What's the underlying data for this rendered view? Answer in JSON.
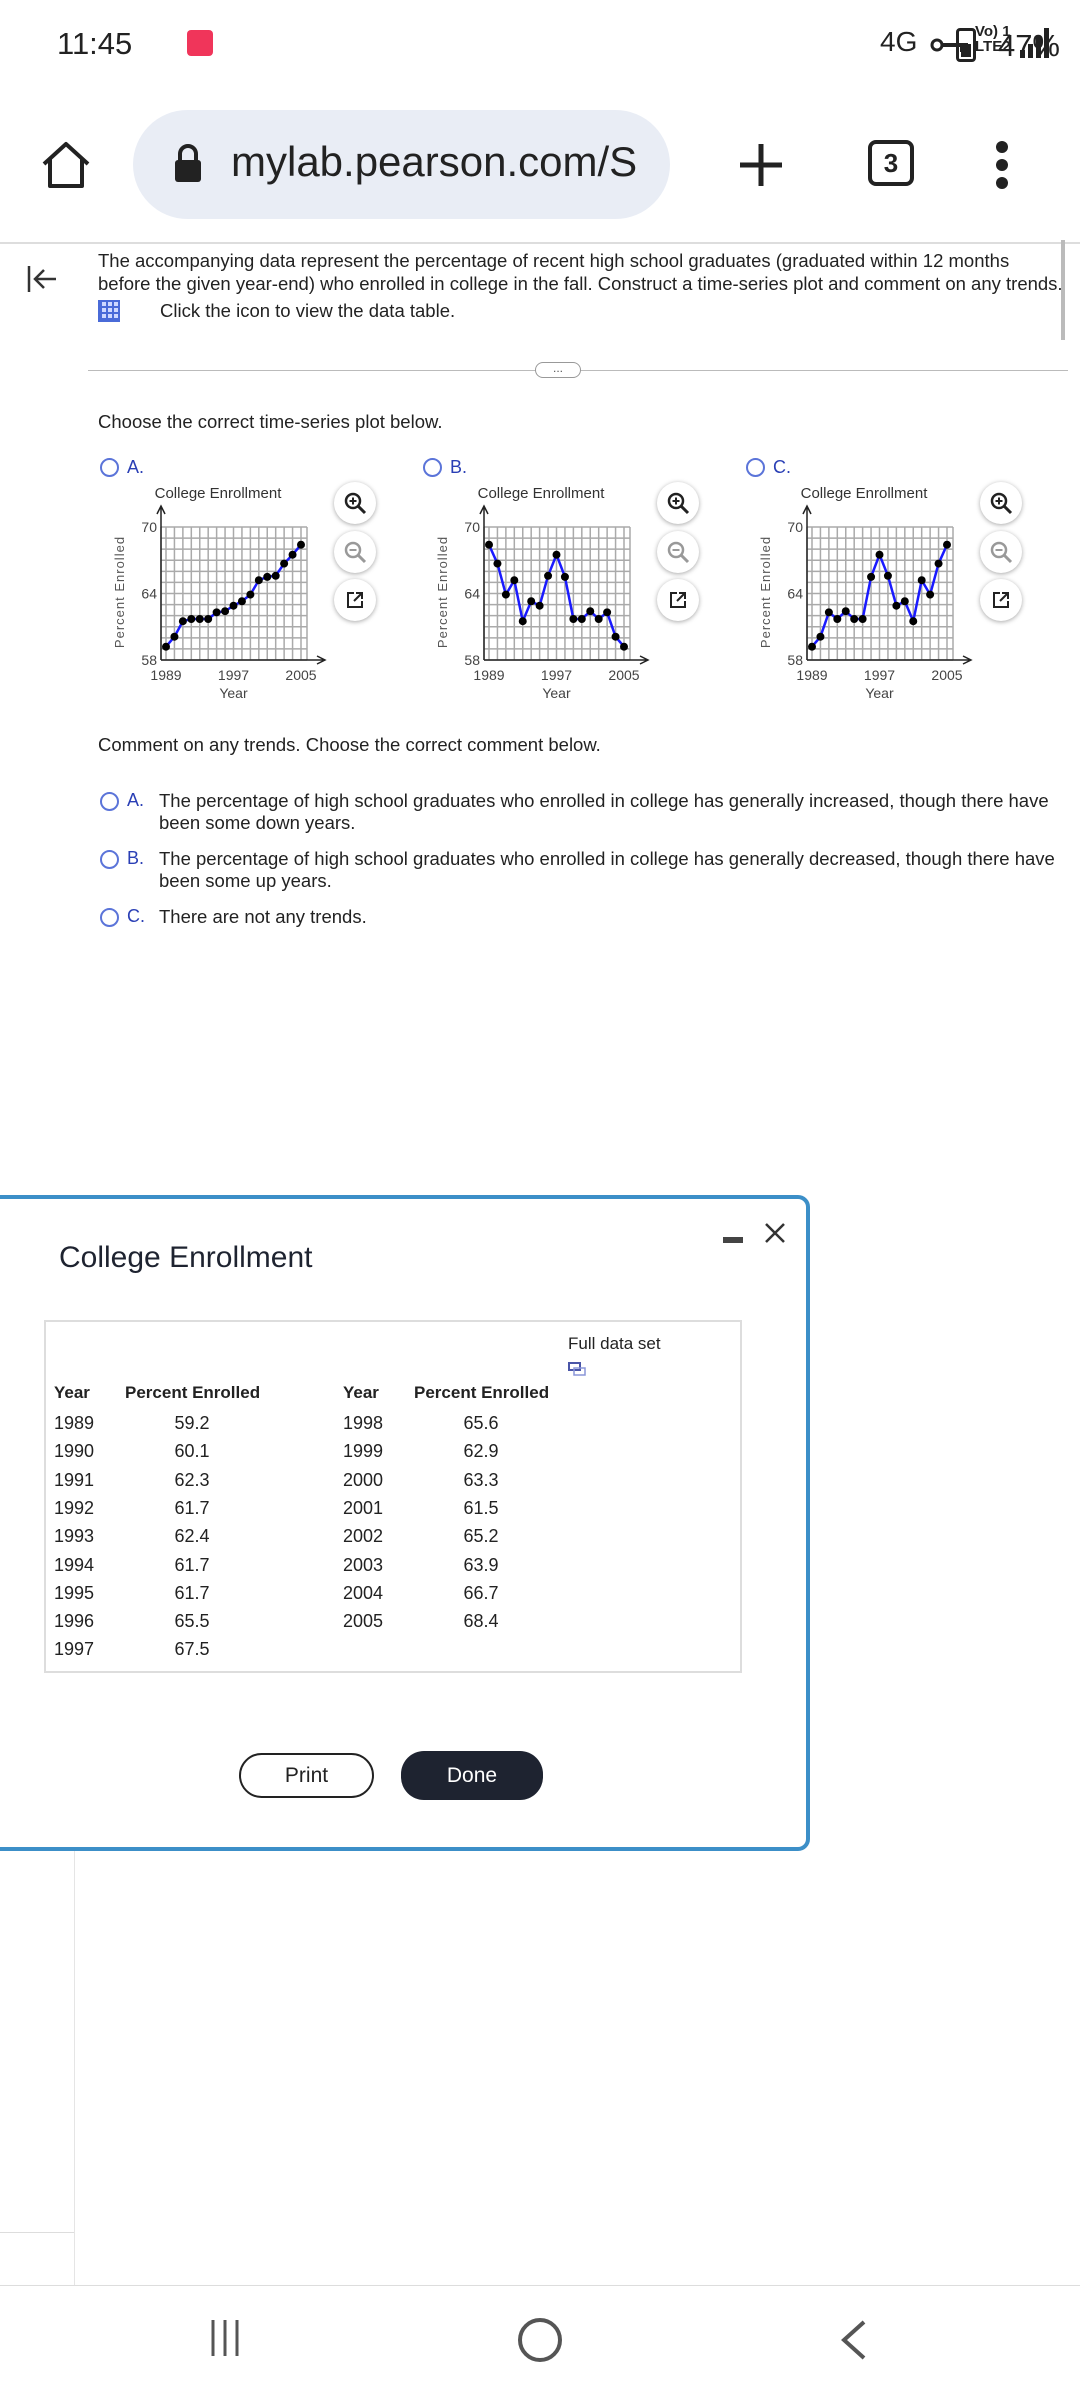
{
  "status_bar": {
    "time": "11:45",
    "network_top": "Vo) 1",
    "network_bottom": "LTE2",
    "network_type": "4G",
    "battery": "47%"
  },
  "browser": {
    "url": "mylab.pearson.com/S",
    "tab_count": "3"
  },
  "question": {
    "line1": "The accompanying data represent the percentage of recent high school graduates (graduated within 12 months",
    "line2": "before the given year-end) who enrolled in college in the fall. Construct a time-series plot and comment on any trends.",
    "table_link": "Click the icon to view the data table.",
    "more": "...",
    "choose_plot": "Choose the correct time-series plot below.",
    "comment_prompt": "Comment on any trends. Choose the correct comment below."
  },
  "plot_options": [
    {
      "label": "A.",
      "title": "College Enrollment",
      "ylabel": "Percent Enrolled",
      "xlabel": "Year"
    },
    {
      "label": "B.",
      "title": "College Enrollment",
      "ylabel": "Percent Enrolled",
      "xlabel": "Year"
    },
    {
      "label": "C.",
      "title": "College Enrollment",
      "ylabel": "Percent Enrolled",
      "xlabel": "Year"
    }
  ],
  "chart_data": [
    {
      "type": "line",
      "title": "College Enrollment",
      "xlabel": "Year",
      "ylabel": "Percent Enrolled",
      "xlim": [
        1989,
        2005
      ],
      "ylim": [
        58,
        70
      ],
      "xticks": [
        "1989",
        "1997",
        "2005"
      ],
      "yticks": [
        "58",
        "64",
        "70"
      ],
      "grid": true,
      "line_color": "#1a1aff",
      "marker_color": "#000000",
      "x": [
        1989,
        1990,
        1991,
        1992,
        1993,
        1994,
        1995,
        1996,
        1997,
        1998,
        1999,
        2000,
        2001,
        2002,
        2003,
        2004,
        2005
      ],
      "values": [
        59.2,
        60.1,
        61.5,
        61.7,
        61.7,
        61.7,
        62.3,
        62.4,
        62.9,
        63.3,
        63.9,
        65.2,
        65.5,
        65.6,
        66.7,
        67.5,
        68.4
      ]
    },
    {
      "type": "line",
      "title": "College Enrollment",
      "xlabel": "Year",
      "ylabel": "Percent Enrolled",
      "xlim": [
        1989,
        2005
      ],
      "ylim": [
        58,
        70
      ],
      "xticks": [
        "1989",
        "1997",
        "2005"
      ],
      "yticks": [
        "58",
        "64",
        "70"
      ],
      "grid": true,
      "line_color": "#1a1aff",
      "marker_color": "#000000",
      "x": [
        1989,
        1990,
        1991,
        1992,
        1993,
        1994,
        1995,
        1996,
        1997,
        1998,
        1999,
        2000,
        2001,
        2002,
        2003,
        2004,
        2005
      ],
      "values": [
        68.4,
        66.7,
        63.9,
        65.2,
        61.5,
        63.3,
        62.9,
        65.6,
        67.5,
        65.5,
        61.7,
        61.7,
        62.4,
        61.7,
        62.3,
        60.1,
        59.2
      ]
    },
    {
      "type": "line",
      "title": "College Enrollment",
      "xlabel": "Year",
      "ylabel": "Percent Enrolled",
      "xlim": [
        1989,
        2005
      ],
      "ylim": [
        58,
        70
      ],
      "xticks": [
        "1989",
        "1997",
        "2005"
      ],
      "yticks": [
        "58",
        "64",
        "70"
      ],
      "grid": true,
      "line_color": "#1a1aff",
      "marker_color": "#000000",
      "x": [
        1989,
        1990,
        1991,
        1992,
        1993,
        1994,
        1995,
        1996,
        1997,
        1998,
        1999,
        2000,
        2001,
        2002,
        2003,
        2004,
        2005
      ],
      "values": [
        59.2,
        60.1,
        62.3,
        61.7,
        62.4,
        61.7,
        61.7,
        65.5,
        67.5,
        65.6,
        62.9,
        63.3,
        61.5,
        65.2,
        63.9,
        66.7,
        68.4
      ]
    }
  ],
  "comment_options": [
    {
      "label": "A.",
      "line1": "The percentage of high school graduates who enrolled in college has generally increased, though there have",
      "line2": "been some down years."
    },
    {
      "label": "B.",
      "line1": "The percentage of high school graduates who enrolled in college has generally decreased, though there have",
      "line2": "been some up years."
    },
    {
      "label": "C.",
      "line1": "There are not any trends.",
      "line2": ""
    }
  ],
  "dialog": {
    "title": "College Enrollment",
    "full_data_set": "Full data set",
    "headers": [
      "Year",
      "Percent Enrolled",
      "Year",
      "Percent Enrolled"
    ],
    "left_rows": [
      [
        "1989",
        "59.2"
      ],
      [
        "1990",
        "60.1"
      ],
      [
        "1991",
        "62.3"
      ],
      [
        "1992",
        "61.7"
      ],
      [
        "1993",
        "62.4"
      ],
      [
        "1994",
        "61.7"
      ],
      [
        "1995",
        "61.7"
      ],
      [
        "1996",
        "65.5"
      ],
      [
        "1997",
        "67.5"
      ]
    ],
    "right_rows": [
      [
        "1998",
        "65.6"
      ],
      [
        "1999",
        "62.9"
      ],
      [
        "2000",
        "63.3"
      ],
      [
        "2001",
        "61.5"
      ],
      [
        "2002",
        "65.2"
      ],
      [
        "2003",
        "63.9"
      ],
      [
        "2004",
        "66.7"
      ],
      [
        "2005",
        "68.4"
      ]
    ],
    "print": "Print",
    "done": "Done"
  },
  "colors": {
    "accent": "#2a3fb5",
    "dialog_border": "#3c8fc8",
    "done_button": "#1e2330"
  }
}
